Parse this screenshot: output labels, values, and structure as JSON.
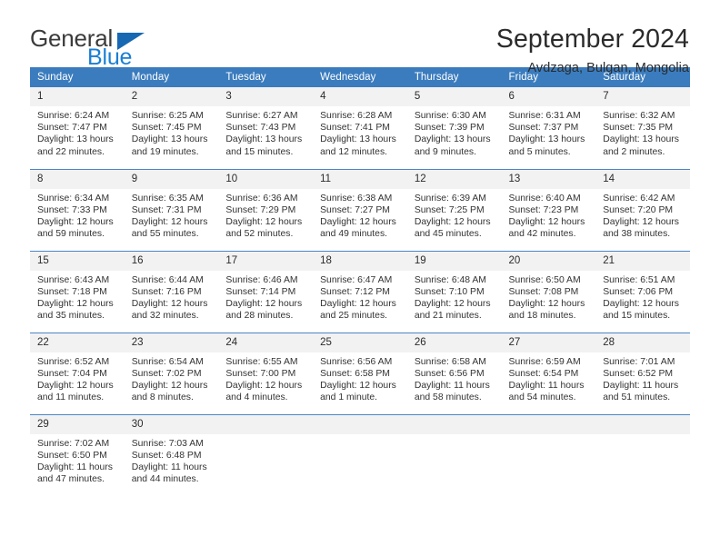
{
  "brand": {
    "word1": "General",
    "word2": "Blue",
    "triangle_icon": "blue-triangle-logo-mark",
    "accent_color": "#1a7fd4",
    "mark_color": "#1668b3"
  },
  "header": {
    "title": "September 2024",
    "subtitle": "Avdzaga, Bulgan, Mongolia"
  },
  "theme": {
    "header_row_bg": "#3b7cbe",
    "header_row_text": "#ffffff",
    "daynum_bg": "#f2f2f2",
    "row_divider": "#4a86c4",
    "body_text": "#333333"
  },
  "weekdays": [
    "Sunday",
    "Monday",
    "Tuesday",
    "Wednesday",
    "Thursday",
    "Friday",
    "Saturday"
  ],
  "weeks": [
    [
      {
        "day": "1",
        "sunrise": "Sunrise: 6:24 AM",
        "sunset": "Sunset: 7:47 PM",
        "daylight": "Daylight: 13 hours and 22 minutes."
      },
      {
        "day": "2",
        "sunrise": "Sunrise: 6:25 AM",
        "sunset": "Sunset: 7:45 PM",
        "daylight": "Daylight: 13 hours and 19 minutes."
      },
      {
        "day": "3",
        "sunrise": "Sunrise: 6:27 AM",
        "sunset": "Sunset: 7:43 PM",
        "daylight": "Daylight: 13 hours and 15 minutes."
      },
      {
        "day": "4",
        "sunrise": "Sunrise: 6:28 AM",
        "sunset": "Sunset: 7:41 PM",
        "daylight": "Daylight: 13 hours and 12 minutes."
      },
      {
        "day": "5",
        "sunrise": "Sunrise: 6:30 AM",
        "sunset": "Sunset: 7:39 PM",
        "daylight": "Daylight: 13 hours and 9 minutes."
      },
      {
        "day": "6",
        "sunrise": "Sunrise: 6:31 AM",
        "sunset": "Sunset: 7:37 PM",
        "daylight": "Daylight: 13 hours and 5 minutes."
      },
      {
        "day": "7",
        "sunrise": "Sunrise: 6:32 AM",
        "sunset": "Sunset: 7:35 PM",
        "daylight": "Daylight: 13 hours and 2 minutes."
      }
    ],
    [
      {
        "day": "8",
        "sunrise": "Sunrise: 6:34 AM",
        "sunset": "Sunset: 7:33 PM",
        "daylight": "Daylight: 12 hours and 59 minutes."
      },
      {
        "day": "9",
        "sunrise": "Sunrise: 6:35 AM",
        "sunset": "Sunset: 7:31 PM",
        "daylight": "Daylight: 12 hours and 55 minutes."
      },
      {
        "day": "10",
        "sunrise": "Sunrise: 6:36 AM",
        "sunset": "Sunset: 7:29 PM",
        "daylight": "Daylight: 12 hours and 52 minutes."
      },
      {
        "day": "11",
        "sunrise": "Sunrise: 6:38 AM",
        "sunset": "Sunset: 7:27 PM",
        "daylight": "Daylight: 12 hours and 49 minutes."
      },
      {
        "day": "12",
        "sunrise": "Sunrise: 6:39 AM",
        "sunset": "Sunset: 7:25 PM",
        "daylight": "Daylight: 12 hours and 45 minutes."
      },
      {
        "day": "13",
        "sunrise": "Sunrise: 6:40 AM",
        "sunset": "Sunset: 7:23 PM",
        "daylight": "Daylight: 12 hours and 42 minutes."
      },
      {
        "day": "14",
        "sunrise": "Sunrise: 6:42 AM",
        "sunset": "Sunset: 7:20 PM",
        "daylight": "Daylight: 12 hours and 38 minutes."
      }
    ],
    [
      {
        "day": "15",
        "sunrise": "Sunrise: 6:43 AM",
        "sunset": "Sunset: 7:18 PM",
        "daylight": "Daylight: 12 hours and 35 minutes."
      },
      {
        "day": "16",
        "sunrise": "Sunrise: 6:44 AM",
        "sunset": "Sunset: 7:16 PM",
        "daylight": "Daylight: 12 hours and 32 minutes."
      },
      {
        "day": "17",
        "sunrise": "Sunrise: 6:46 AM",
        "sunset": "Sunset: 7:14 PM",
        "daylight": "Daylight: 12 hours and 28 minutes."
      },
      {
        "day": "18",
        "sunrise": "Sunrise: 6:47 AM",
        "sunset": "Sunset: 7:12 PM",
        "daylight": "Daylight: 12 hours and 25 minutes."
      },
      {
        "day": "19",
        "sunrise": "Sunrise: 6:48 AM",
        "sunset": "Sunset: 7:10 PM",
        "daylight": "Daylight: 12 hours and 21 minutes."
      },
      {
        "day": "20",
        "sunrise": "Sunrise: 6:50 AM",
        "sunset": "Sunset: 7:08 PM",
        "daylight": "Daylight: 12 hours and 18 minutes."
      },
      {
        "day": "21",
        "sunrise": "Sunrise: 6:51 AM",
        "sunset": "Sunset: 7:06 PM",
        "daylight": "Daylight: 12 hours and 15 minutes."
      }
    ],
    [
      {
        "day": "22",
        "sunrise": "Sunrise: 6:52 AM",
        "sunset": "Sunset: 7:04 PM",
        "daylight": "Daylight: 12 hours and 11 minutes."
      },
      {
        "day": "23",
        "sunrise": "Sunrise: 6:54 AM",
        "sunset": "Sunset: 7:02 PM",
        "daylight": "Daylight: 12 hours and 8 minutes."
      },
      {
        "day": "24",
        "sunrise": "Sunrise: 6:55 AM",
        "sunset": "Sunset: 7:00 PM",
        "daylight": "Daylight: 12 hours and 4 minutes."
      },
      {
        "day": "25",
        "sunrise": "Sunrise: 6:56 AM",
        "sunset": "Sunset: 6:58 PM",
        "daylight": "Daylight: 12 hours and 1 minute."
      },
      {
        "day": "26",
        "sunrise": "Sunrise: 6:58 AM",
        "sunset": "Sunset: 6:56 PM",
        "daylight": "Daylight: 11 hours and 58 minutes."
      },
      {
        "day": "27",
        "sunrise": "Sunrise: 6:59 AM",
        "sunset": "Sunset: 6:54 PM",
        "daylight": "Daylight: 11 hours and 54 minutes."
      },
      {
        "day": "28",
        "sunrise": "Sunrise: 7:01 AM",
        "sunset": "Sunset: 6:52 PM",
        "daylight": "Daylight: 11 hours and 51 minutes."
      }
    ],
    [
      {
        "day": "29",
        "sunrise": "Sunrise: 7:02 AM",
        "sunset": "Sunset: 6:50 PM",
        "daylight": "Daylight: 11 hours and 47 minutes."
      },
      {
        "day": "30",
        "sunrise": "Sunrise: 7:03 AM",
        "sunset": "Sunset: 6:48 PM",
        "daylight": "Daylight: 11 hours and 44 minutes."
      },
      {
        "day": "",
        "sunrise": "",
        "sunset": "",
        "daylight": ""
      },
      {
        "day": "",
        "sunrise": "",
        "sunset": "",
        "daylight": ""
      },
      {
        "day": "",
        "sunrise": "",
        "sunset": "",
        "daylight": ""
      },
      {
        "day": "",
        "sunrise": "",
        "sunset": "",
        "daylight": ""
      },
      {
        "day": "",
        "sunrise": "",
        "sunset": "",
        "daylight": ""
      }
    ]
  ]
}
